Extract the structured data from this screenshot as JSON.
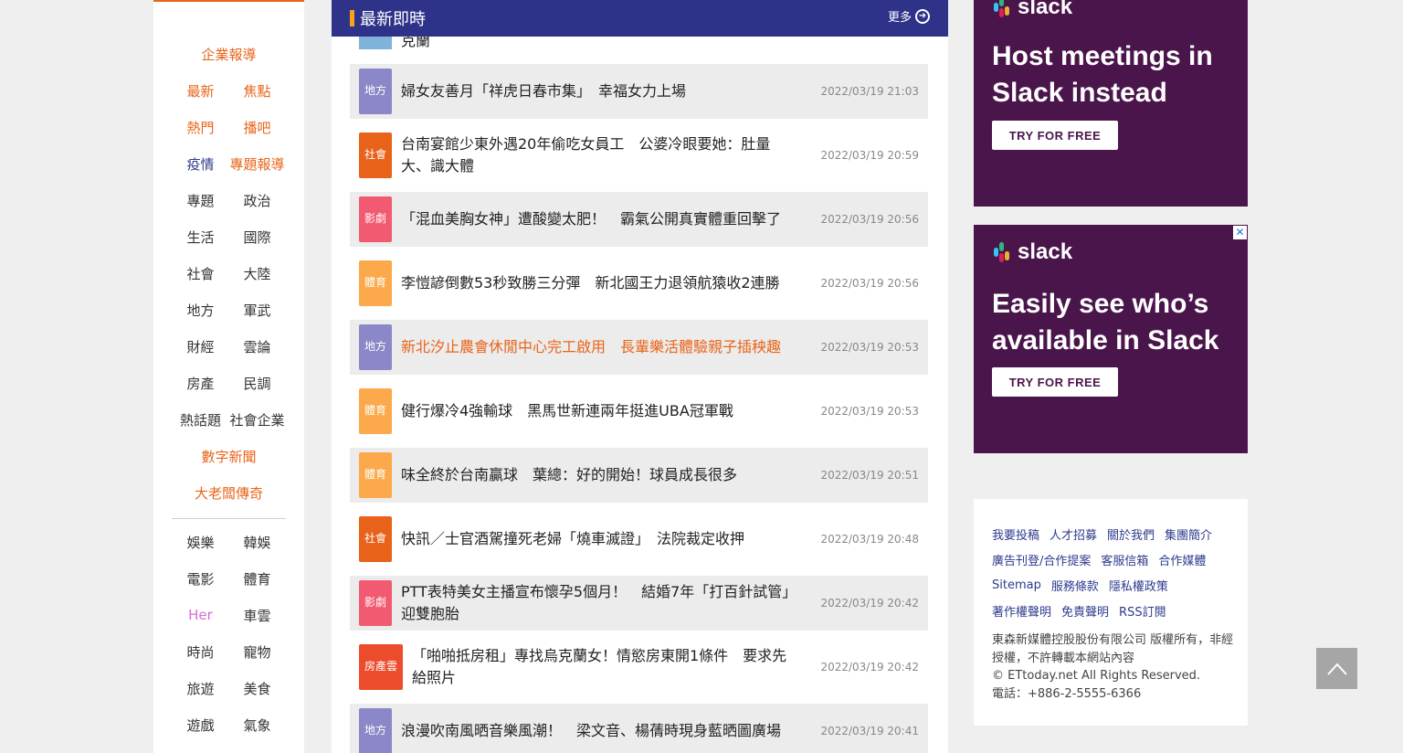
{
  "nav": {
    "top_rows": [
      {
        "cells": [
          {
            "label": "企業報導",
            "color": "orange"
          }
        ]
      },
      {
        "cells": [
          {
            "label": "最新",
            "color": "orange"
          },
          {
            "label": "焦點",
            "color": "orange"
          }
        ]
      },
      {
        "cells": [
          {
            "label": "熱門",
            "color": "orange"
          },
          {
            "label": "播吧",
            "color": "orange"
          }
        ]
      },
      {
        "cells": [
          {
            "label": "疫情",
            "color": "navy"
          },
          {
            "label": "專題報導",
            "color": "orange"
          }
        ]
      },
      {
        "cells": [
          {
            "label": "專題",
            "color": "dark"
          },
          {
            "label": "政治",
            "color": "dark"
          }
        ]
      },
      {
        "cells": [
          {
            "label": "生活",
            "color": "dark"
          },
          {
            "label": "國際",
            "color": "dark"
          }
        ]
      },
      {
        "cells": [
          {
            "label": "社會",
            "color": "dark"
          },
          {
            "label": "大陸",
            "color": "dark"
          }
        ]
      },
      {
        "cells": [
          {
            "label": "地方",
            "color": "dark"
          },
          {
            "label": "軍武",
            "color": "dark"
          }
        ]
      },
      {
        "cells": [
          {
            "label": "財經",
            "color": "dark"
          },
          {
            "label": "雲論",
            "color": "dark"
          }
        ]
      },
      {
        "cells": [
          {
            "label": "房產",
            "color": "dark"
          },
          {
            "label": "民調",
            "color": "dark"
          }
        ]
      },
      {
        "cells": [
          {
            "label": "熱話題",
            "color": "dark"
          },
          {
            "label": "社會企業",
            "color": "dark"
          }
        ]
      },
      {
        "cells": [
          {
            "label": "數字新聞",
            "color": "orange"
          }
        ]
      },
      {
        "cells": [
          {
            "label": "大老闆傳奇",
            "color": "orange"
          }
        ]
      }
    ],
    "bottom_rows": [
      {
        "cells": [
          {
            "label": "娛樂",
            "color": "dark"
          },
          {
            "label": "韓娛",
            "color": "dark"
          }
        ]
      },
      {
        "cells": [
          {
            "label": "電影",
            "color": "dark"
          },
          {
            "label": "體育",
            "color": "dark"
          }
        ]
      },
      {
        "cells": [
          {
            "label": "Her",
            "color": "pink"
          },
          {
            "label": "車雲",
            "color": "dark"
          }
        ]
      },
      {
        "cells": [
          {
            "label": "時尚",
            "color": "dark"
          },
          {
            "label": "寵物",
            "color": "dark"
          }
        ]
      },
      {
        "cells": [
          {
            "label": "旅遊",
            "color": "dark"
          },
          {
            "label": "美食",
            "color": "dark"
          }
        ]
      },
      {
        "cells": [
          {
            "label": "遊戲",
            "color": "dark"
          },
          {
            "label": "氣象",
            "color": "dark"
          }
        ]
      }
    ]
  },
  "header": {
    "title": "最新即時",
    "more_label": "更多"
  },
  "peek_text": "克蘭",
  "news": [
    {
      "category": "地方",
      "kind": "local",
      "title": "婦女友善月「祥虎日春市集」　幸福女力上場",
      "time": "2022/03/19 21:03",
      "highlight": false
    },
    {
      "category": "社會",
      "kind": "social",
      "title": "台南宴館少東外遇20年偷吃女員工　公婆冷眼要她：肚量大、識大體",
      "time": "2022/03/19 20:59",
      "highlight": false
    },
    {
      "category": "影劇",
      "kind": "drama",
      "title": "「混血美胸女神」遭酸變太肥！　霸氣公開真實體重回擊了",
      "time": "2022/03/19 20:56",
      "highlight": false
    },
    {
      "category": "體育",
      "kind": "sports",
      "title": "李愷諺倒數53秒致勝三分彈　新北國王力退領航猿收2連勝",
      "time": "2022/03/19 20:56",
      "highlight": false
    },
    {
      "category": "地方",
      "kind": "local",
      "title": "新北汐止農會休閒中心完工啟用　長輩樂活體驗親子插秧趣",
      "time": "2022/03/19 20:53",
      "highlight": true
    },
    {
      "category": "體育",
      "kind": "sports",
      "title": "健行爆冷4強輸球　黑馬世新連兩年挺進UBA冠軍戰",
      "time": "2022/03/19 20:53",
      "highlight": false
    },
    {
      "category": "體育",
      "kind": "sports",
      "title": "味全終於台南贏球　葉總：好的開始！球員成長很多",
      "time": "2022/03/19 20:51",
      "highlight": false
    },
    {
      "category": "社會",
      "kind": "social",
      "title": "快訊／士官酒駕撞死老婦「燒車滅證」　法院裁定收押",
      "time": "2022/03/19 20:48",
      "highlight": false
    },
    {
      "category": "影劇",
      "kind": "drama",
      "title": "PTT表特美女主播宣布懷孕5個月！　結婚7年「打百針試管」迎雙胞胎",
      "time": "2022/03/19 20:42",
      "highlight": false
    },
    {
      "category": "房產雲",
      "kind": "estate",
      "title": "「啪啪抵房租」專找烏克蘭女！情慾房東開1條件　要求先給照片",
      "time": "2022/03/19 20:42",
      "highlight": false
    },
    {
      "category": "地方",
      "kind": "local",
      "title": "浪漫吹南風晒音樂風潮！　梁文音、楊蒨時現身藍晒圖廣場",
      "time": "2022/03/19 20:41",
      "highlight": false
    }
  ],
  "ads": [
    {
      "brand": "slack",
      "headline_lines": [
        "Host meetings in",
        "Slack instead"
      ],
      "cta": "TRY FOR FREE"
    },
    {
      "brand": "slack",
      "headline_lines": [
        "Easily see who’s",
        "available in Slack"
      ],
      "cta": "TRY FOR FREE",
      "close": "✕"
    }
  ],
  "footer": {
    "link_rows": [
      [
        "我要投稿",
        "人才招募",
        "關於我們",
        "集團簡介"
      ],
      [
        "廣告刊登/合作提案",
        "客服信箱",
        "合作媒體"
      ],
      [
        "Sitemap",
        "服務條款",
        "隱私權政策"
      ],
      [
        "著作權聲明",
        "免責聲明",
        "RSS訂閱"
      ]
    ],
    "copyright_lines": [
      "東森新媒體控股股份有限公司 版權所有，非經授權，不許轉載本網站內容",
      "© ETtoday.net All Rights Reserved.",
      "電話：+886-2-5555-6366"
    ]
  },
  "colors": {
    "brand_orange": "#e8651a",
    "header_navy": "#2e3389",
    "slack_purple": "#4a154b"
  }
}
